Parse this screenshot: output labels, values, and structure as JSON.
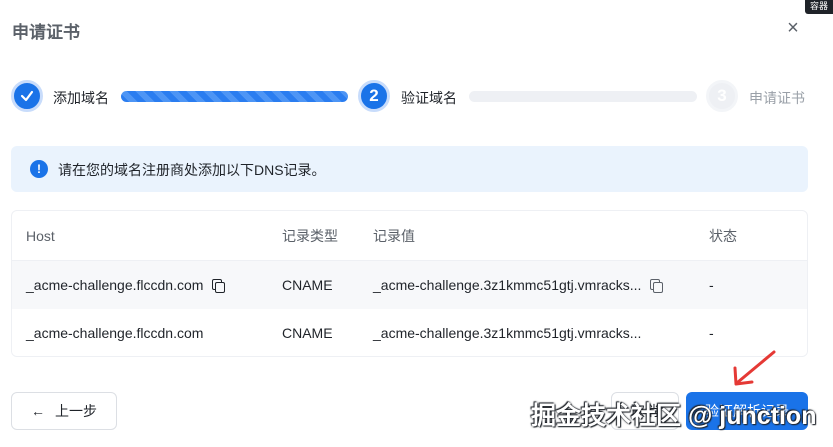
{
  "dialog": {
    "title": "申请证书",
    "close_icon": "×",
    "corner_badge": "容器"
  },
  "steps": [
    {
      "number": "✓",
      "label": "添加域名",
      "status": "done"
    },
    {
      "number": "2",
      "label": "验证域名",
      "status": "active"
    },
    {
      "number": "3",
      "label": "申请证书",
      "status": "pending"
    }
  ],
  "alert": {
    "icon": "!",
    "text": "请在您的域名注册商处添加以下DNS记录。"
  },
  "table": {
    "headers": [
      "Host",
      "记录类型",
      "记录值",
      "状态"
    ],
    "rows": [
      {
        "host": "_acme-challenge.flccdn.com",
        "type": "CNAME",
        "value": "_acme-challenge.3z1kmmc51gtj.vmracks...",
        "status": "-"
      },
      {
        "host": "_acme-challenge.flccdn.com",
        "type": "CNAME",
        "value": "_acme-challenge.3z1kmmc51gtj.vmracks...",
        "status": "-"
      }
    ]
  },
  "footer": {
    "back_icon": "←",
    "back_label": "上一步",
    "cancel_label": "取消",
    "verify_label": "验证解析记录"
  },
  "watermark": "掘金技术社区 @ junction",
  "colors": {
    "primary": "#1a73e8",
    "alert_bg": "#eaf3fd",
    "annotation_arrow": "#e53935"
  }
}
